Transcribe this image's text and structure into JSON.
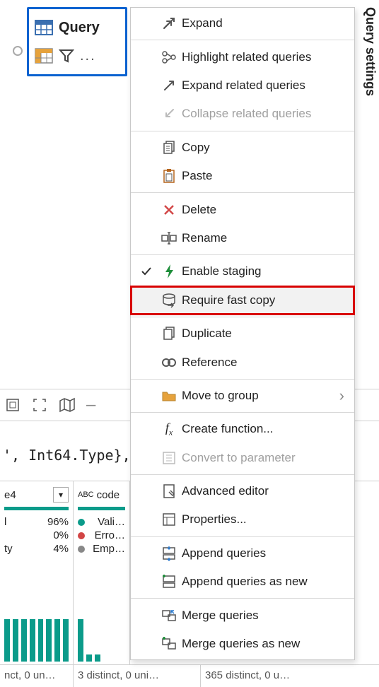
{
  "node": {
    "title": "Query",
    "ellipsis": "..."
  },
  "vertical_label": "Query settings",
  "menu": {
    "expand": "Expand",
    "highlight_related": "Highlight related queries",
    "expand_related": "Expand related queries",
    "collapse_related": "Collapse related queries",
    "copy": "Copy",
    "paste": "Paste",
    "delete": "Delete",
    "rename": "Rename",
    "enable_staging": "Enable staging",
    "require_fast_copy": "Require fast copy",
    "duplicate": "Duplicate",
    "reference": "Reference",
    "move_to_group": "Move to group",
    "create_function": "Create function...",
    "convert_to_parameter": "Convert to parameter",
    "advanced_editor": "Advanced editor",
    "properties": "Properties...",
    "append_queries": "Append queries",
    "append_queries_as_new": "Append queries as new",
    "merge_queries": "Merge queries",
    "merge_queries_as_new": "Merge queries as new"
  },
  "code_fragment": "', Int64.Type},",
  "columns": {
    "col1": {
      "header": "e4",
      "stats": [
        {
          "label": "l",
          "value": "96%"
        },
        {
          "label": "",
          "value": "0%"
        },
        {
          "label": "ty",
          "value": "4%"
        }
      ]
    },
    "col2": {
      "header": "code",
      "header_prefix": "ABC",
      "stats": [
        {
          "label": "Vali…",
          "color": "#0b9b8a"
        },
        {
          "label": "Erro…",
          "color": "#d24545"
        },
        {
          "label": "Emp…",
          "color": "#888"
        }
      ]
    }
  },
  "distinct": {
    "a": "nct, 0 un…",
    "b": "3 distinct, 0 uni…",
    "c": "365 distinct, 0 u…"
  }
}
